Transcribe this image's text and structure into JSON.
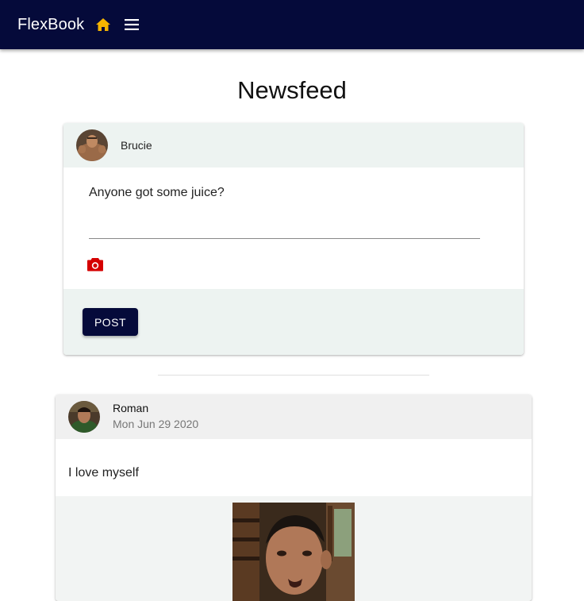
{
  "app": {
    "brand": "FlexBook",
    "accent_color": "#050a3a",
    "home_icon_color": "#f5b400",
    "camera_icon_color": "#d50000"
  },
  "page": {
    "title": "Newsfeed"
  },
  "composer": {
    "author": "Brucie",
    "avatar_icon": "avatar-photo",
    "input_value": "Anyone got some juice?",
    "camera_icon": "camera-icon",
    "post_label": "POST"
  },
  "feed": [
    {
      "author": "Roman",
      "date": "Mon Jun 29 2020",
      "text": "I love myself",
      "has_image": true
    }
  ]
}
